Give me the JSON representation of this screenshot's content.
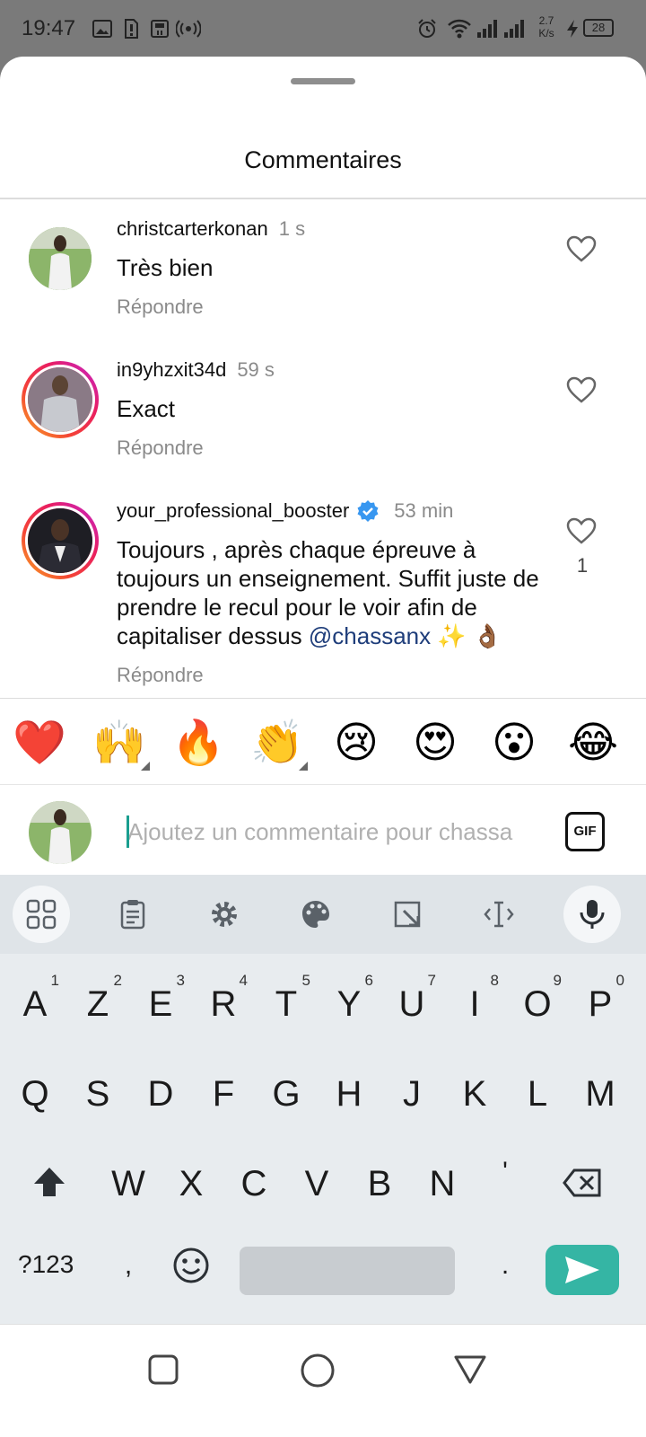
{
  "status_bar": {
    "time": "19:47",
    "speed_value": "2.7",
    "speed_unit": "K/s",
    "battery": "28"
  },
  "sheet": {
    "title": "Commentaires"
  },
  "comments": [
    {
      "username": "christcarterkonan",
      "time": "1 s",
      "text": "Très bien",
      "reply": "Répondre"
    },
    {
      "username": "in9yhzxit34d",
      "time": "59 s",
      "text": "Exact",
      "reply": "Répondre"
    },
    {
      "username": "your_professional_booster",
      "time": "53 min",
      "text": "Toujours , après chaque épreuve à toujours un enseignement. Suffit juste de prendre le recul pour le voir afin de capitaliser dessus ",
      "mention": "@chassanx",
      "emojis": " ✨ 👌🏾",
      "reply": "Répondre",
      "likes": "1"
    }
  ],
  "emoji_bar": [
    "❤️",
    "🙌",
    "🔥",
    "👏",
    "😢",
    "😍",
    "😮",
    "😂"
  ],
  "comment_input": {
    "placeholder": "Ajoutez un commentaire pour chassa",
    "gif_label": "GIF"
  },
  "keyboard": {
    "row1": [
      {
        "k": "A",
        "h": "1"
      },
      {
        "k": "Z",
        "h": "2"
      },
      {
        "k": "E",
        "h": "3"
      },
      {
        "k": "R",
        "h": "4"
      },
      {
        "k": "T",
        "h": "5"
      },
      {
        "k": "Y",
        "h": "6"
      },
      {
        "k": "U",
        "h": "7"
      },
      {
        "k": "I",
        "h": "8"
      },
      {
        "k": "O",
        "h": "9"
      },
      {
        "k": "P",
        "h": "0"
      }
    ],
    "row2": [
      "Q",
      "S",
      "D",
      "F",
      "G",
      "H",
      "J",
      "K",
      "L",
      "M"
    ],
    "row3": [
      "W",
      "X",
      "C",
      "V",
      "B",
      "N",
      "'"
    ],
    "symbols_label": "?123",
    "comma": ",",
    "period": "."
  },
  "colors": {
    "accent": "#35b5a4",
    "verified": "#3897f0",
    "heart": "#e0245e"
  },
  "icons": [
    "gallery-icon",
    "sim-alert-icon",
    "sd-card-icon",
    "hotspot-icon",
    "alarm-icon",
    "wifi-icon",
    "signal-icon",
    "charging-icon",
    "apps-grid-icon",
    "clipboard-icon",
    "settings-icon",
    "palette-icon",
    "resize-icon",
    "text-cursor-icon",
    "microphone-icon",
    "shift-icon",
    "backspace-icon",
    "emoji-icon",
    "send-icon",
    "recents-icon",
    "home-icon",
    "back-icon"
  ]
}
